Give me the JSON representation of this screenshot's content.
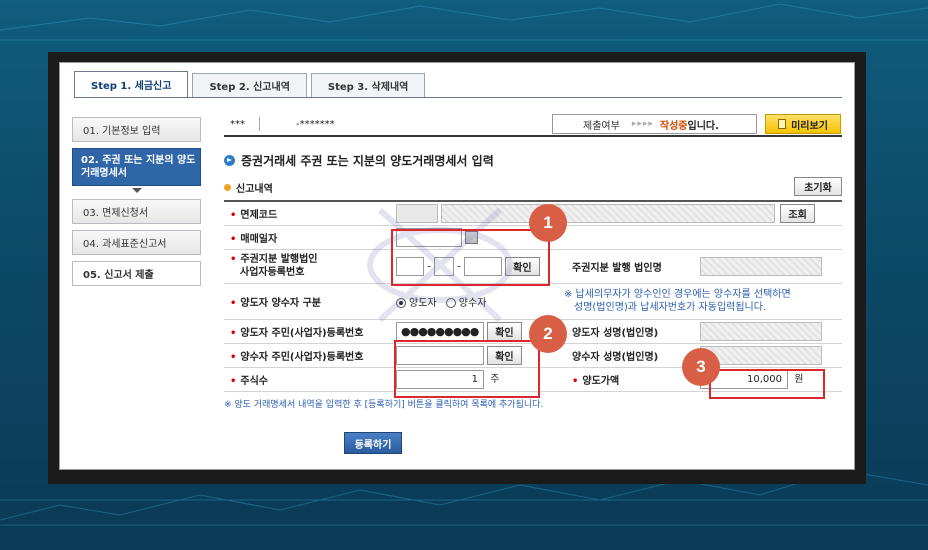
{
  "tabs": [
    {
      "label": "Step 1. 세금신고",
      "active": true
    },
    {
      "label": "Step 2. 신고내역",
      "active": false
    },
    {
      "label": "Step 3. 삭제내역",
      "active": false
    }
  ],
  "sidebar": {
    "items": [
      {
        "label": "01. 기본정보 입력"
      },
      {
        "label": "02. 주권 또는 지분의 양도거래명세서"
      },
      {
        "label": "03. 면제신청서"
      },
      {
        "label": "04. 과세표준신고서"
      },
      {
        "label": "05. 신고서 제출"
      }
    ]
  },
  "topbar": {
    "masked_id": "***",
    "masked_no": "-*******",
    "status_label": "제출여부",
    "status_arrows": "▸▸▸▸",
    "status_value": "작성중",
    "status_suffix": "입니다.",
    "preview_label": "미리보기"
  },
  "section": {
    "title": "증권거래세 주권 또는 지분의 양도거래명세서 입력",
    "sub_title": "신고내역",
    "reset_label": "초기화"
  },
  "form": {
    "exempt_code_label": "면제코드",
    "lookup_label": "조회",
    "trade_date_label": "매매일자",
    "issuer_bizno_label_1": "주권지분 발행법인",
    "issuer_bizno_label_2": "사업자등록번호",
    "confirm_label": "확인",
    "issuer_name_label": "주권지분 발행 법인명",
    "type_label": "양도자 양수자 구분",
    "radio_transferor": "양도자",
    "radio_transferee": "양수자",
    "note_line1": "※ 납세의무자가 양수인인 경우에는 양수자를 선택하면",
    "note_line2": "성명(법인명)과 납세자번호가 자동입력됩니다.",
    "transferor_id_label": "양도자 주민(사업자)등록번호",
    "transferor_id_value": "●●●●●●●●●",
    "transferor_name_label": "양도자 성명(법인명)",
    "transferee_id_label": "양수자 주민(사업자)등록번호",
    "transferee_name_label": "양수자 성명(법인명)",
    "shares_label": "주식수",
    "shares_value": "1",
    "shares_unit": "주",
    "amount_label": "양도가액",
    "amount_value": "10,000",
    "amount_unit": "원",
    "bizno_dash": "-"
  },
  "footnote": "※ 양도 거래명세서 내역을 입력한 후 [등록하기] 버튼을 클릭하여 목록에 추가됩니다.",
  "register_label": "등록하기",
  "badges": [
    "1",
    "2",
    "3"
  ],
  "colors": {
    "accent": "#2f66a8",
    "status": "#d44a00",
    "annotation": "#d9282f",
    "badge": "#d85f45"
  }
}
